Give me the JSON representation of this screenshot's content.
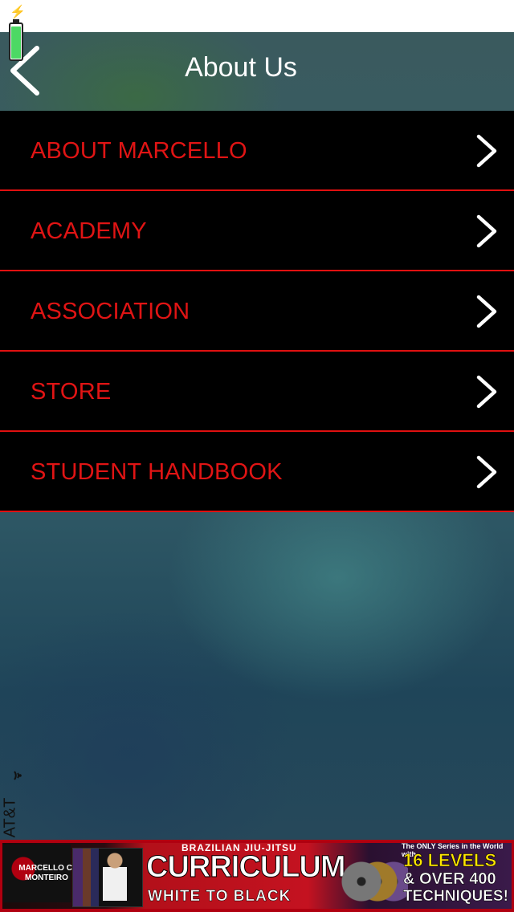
{
  "status_bar": {
    "carrier": "AT&T",
    "battery_level": 0.9,
    "charging_icon": "lightning-bolt-icon",
    "wifi_icon": "wifi-icon"
  },
  "nav": {
    "title": "About Us",
    "back_icon": "chevron-left-icon"
  },
  "menu": {
    "items": [
      {
        "label": "ABOUT MARCELLO",
        "icon": "chevron-right-icon"
      },
      {
        "label": "ACADEMY",
        "icon": "chevron-right-icon"
      },
      {
        "label": "ASSOCIATION",
        "icon": "chevron-right-icon"
      },
      {
        "label": "STORE",
        "icon": "chevron-right-icon"
      },
      {
        "label": "STUDENT HANDBOOK",
        "icon": "chevron-right-icon"
      }
    ]
  },
  "ad": {
    "brand": "MARCELLO C. MONTEIRO",
    "top_text": "BRAZILIAN JIU-JITSU",
    "main_text": "CURRICULUM",
    "sub_text": "WHITE TO BLACK",
    "right_small": "The ONLY Series in the World with",
    "levels": "16 LEVELS",
    "over": "& OVER 400",
    "techniques": "TECHNIQUES!"
  },
  "colors": {
    "menu_text": "#e01414",
    "menu_divider": "#e01010",
    "menu_bg": "#000000",
    "title_text": "#ffffff",
    "battery_fill": "#4cd964"
  }
}
